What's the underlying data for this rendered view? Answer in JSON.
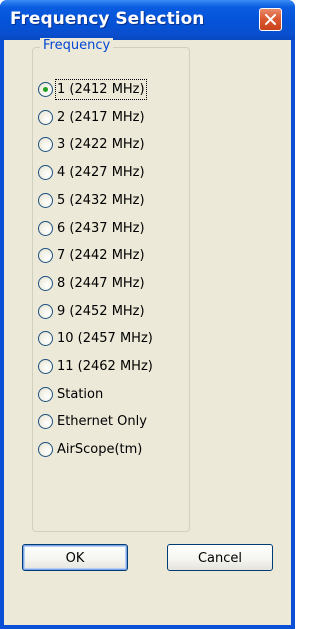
{
  "window": {
    "title": "Frequency Selection"
  },
  "group": {
    "legend": "Frequency"
  },
  "options": [
    {
      "label": "1 (2412 MHz)",
      "selected": true
    },
    {
      "label": "2 (2417 MHz)",
      "selected": false
    },
    {
      "label": "3 (2422 MHz)",
      "selected": false
    },
    {
      "label": "4 (2427 MHz)",
      "selected": false
    },
    {
      "label": "5 (2432 MHz)",
      "selected": false
    },
    {
      "label": "6 (2437 MHz)",
      "selected": false
    },
    {
      "label": "7 (2442 MHz)",
      "selected": false
    },
    {
      "label": "8 (2447 MHz)",
      "selected": false
    },
    {
      "label": "9 (2452 MHz)",
      "selected": false
    },
    {
      "label": "10 (2457 MHz)",
      "selected": false
    },
    {
      "label": "11 (2462 MHz)",
      "selected": false
    },
    {
      "label": "Station",
      "selected": false
    },
    {
      "label": "Ethernet Only",
      "selected": false
    },
    {
      "label": "AirScope(tm)",
      "selected": false
    }
  ],
  "buttons": {
    "ok_label": "OK",
    "cancel_label": "Cancel"
  },
  "icons": {
    "close": "close-icon",
    "radio": "radio-button-icon"
  },
  "colors": {
    "titlebar": "#0453d8",
    "dialog_bg": "#ece9d8",
    "close_button": "#dc5a32",
    "legend_text": "#0046d5",
    "radio_selected_dot": "#21a121"
  }
}
